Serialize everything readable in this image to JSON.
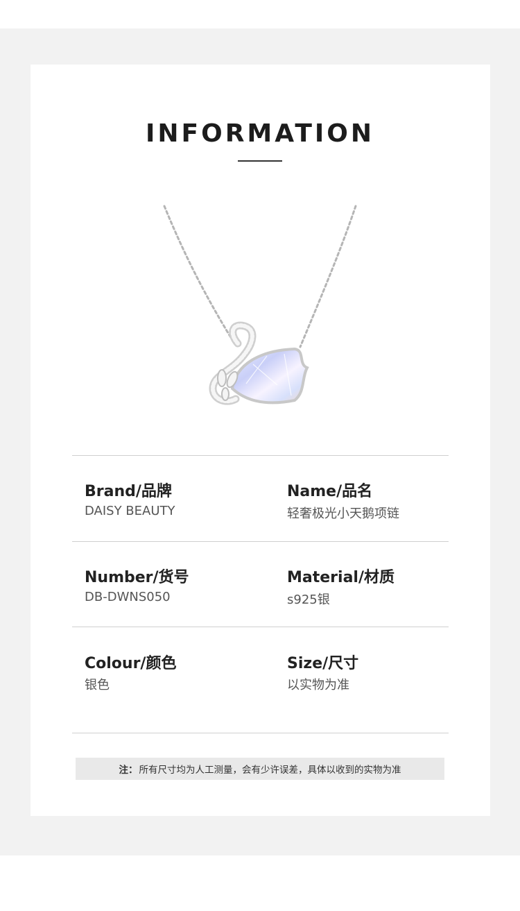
{
  "header": {
    "title": "INFORMATION"
  },
  "product": {
    "image_alt": "swan-necklace"
  },
  "specs": {
    "brand": {
      "label": "Brand/品牌",
      "value": "DAISY BEAUTY"
    },
    "name": {
      "label": "Name/品名",
      "value": "轻奢极光小天鹅项链"
    },
    "number": {
      "label": "Number/货号",
      "value": "DB-DWNS050"
    },
    "material": {
      "label": "Material/材质",
      "value": "s925银"
    },
    "colour": {
      "label": "Colour/颜色",
      "value": "银色"
    },
    "size": {
      "label": "Size/尺寸",
      "value": "以实物为准"
    }
  },
  "note": {
    "prefix": "注：",
    "text": "所有尺寸均为人工测量，会有少许误差，具体以收到的实物为准"
  },
  "colors": {
    "band": "#f2f2f2",
    "card": "#ffffff",
    "text": "#222222",
    "note_bg": "#e9e9e9"
  }
}
